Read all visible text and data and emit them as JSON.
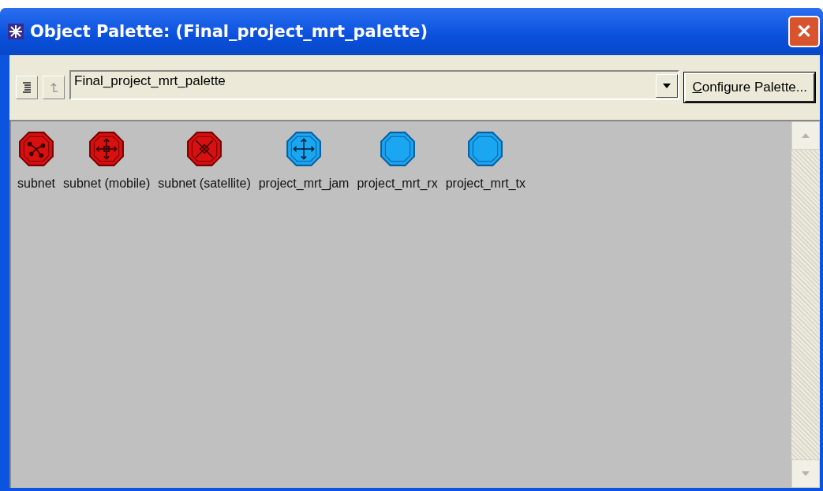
{
  "window": {
    "title": "Object Palette: (Final_project_mrt_palette)",
    "close": "✕"
  },
  "toolbar": {
    "palette": {
      "value": "Final_project_mrt_palette"
    },
    "configure_button": "Configure Palette..."
  },
  "items": [
    {
      "label": "subnet",
      "kind": "subnet"
    },
    {
      "label": "subnet (mobile)",
      "kind": "mobile-subnet"
    },
    {
      "label": "subnet (satellite)",
      "kind": "satellite-subnet"
    },
    {
      "label": "project_mrt_jam",
      "kind": "jammer-node"
    },
    {
      "label": "project_mrt_rx",
      "kind": "node"
    },
    {
      "label": "project_mrt_tx",
      "kind": "node"
    }
  ]
}
